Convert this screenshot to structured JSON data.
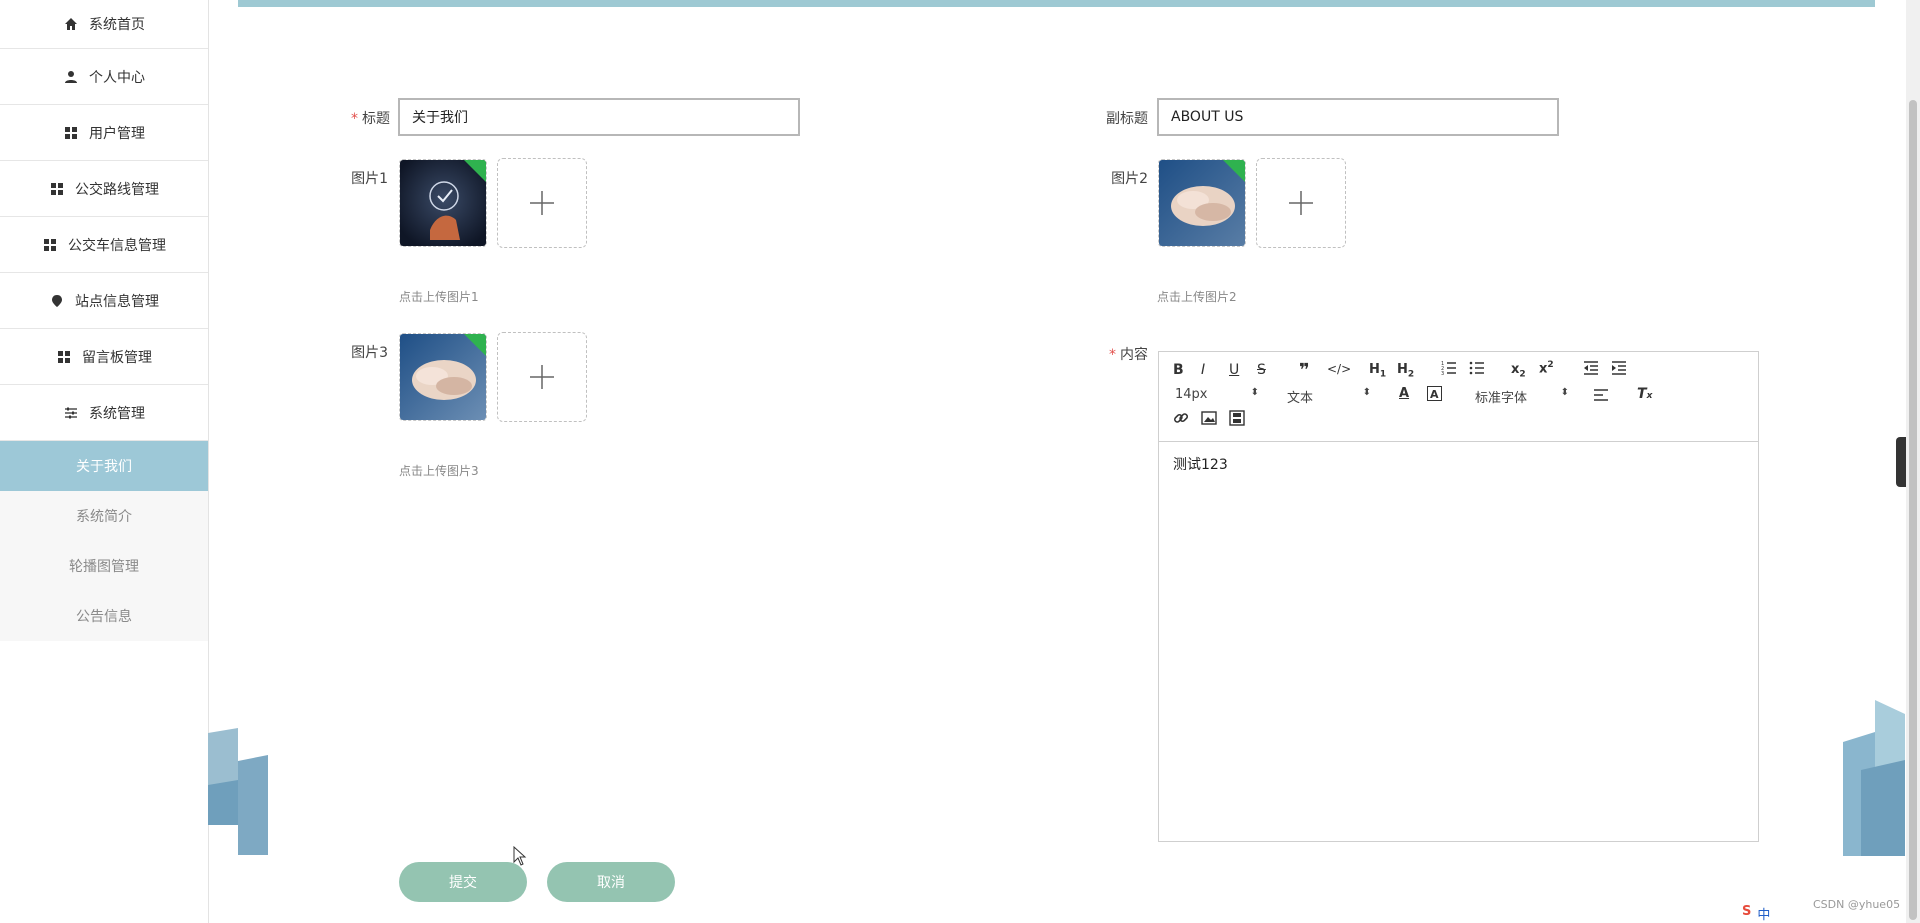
{
  "sidebar": {
    "items": [
      {
        "label": "系统首页",
        "icon": "home-icon"
      },
      {
        "label": "个人中心",
        "icon": "user-icon"
      },
      {
        "label": "用户管理",
        "icon": "grid-icon"
      },
      {
        "label": "公交路线管理",
        "icon": "grid-icon"
      },
      {
        "label": "公交车信息管理",
        "icon": "grid-icon"
      },
      {
        "label": "站点信息管理",
        "icon": "location-icon"
      },
      {
        "label": "留言板管理",
        "icon": "grid-icon"
      },
      {
        "label": "系统管理",
        "icon": "sliders-icon"
      }
    ],
    "subitems": [
      {
        "label": "关于我们",
        "active": true
      },
      {
        "label": "系统简介",
        "active": false
      },
      {
        "label": "轮播图管理",
        "active": false
      },
      {
        "label": "公告信息",
        "active": false
      }
    ]
  },
  "form": {
    "title_label": "标题",
    "title_value": "关于我们",
    "subtitle_label": "副标题",
    "subtitle_value": "ABOUT US",
    "image1_label": "图片1",
    "image1_hint": "点击上传图片1",
    "image2_label": "图片2",
    "image2_hint": "点击上传图片2",
    "image3_label": "图片3",
    "image3_hint": "点击上传图片3",
    "content_label": "内容",
    "required_mark": "*"
  },
  "editor": {
    "font_size": "14px",
    "text_style": "文本",
    "font_family": "标准字体",
    "content": "测试123"
  },
  "buttons": {
    "submit": "提交",
    "cancel": "取消"
  },
  "footer": {
    "watermark": "CSDN @yhue05",
    "ime": "中"
  },
  "colors": {
    "sidebar_active": "#9dc8d7",
    "button": "#94c4b1",
    "required": "#e2504c"
  }
}
